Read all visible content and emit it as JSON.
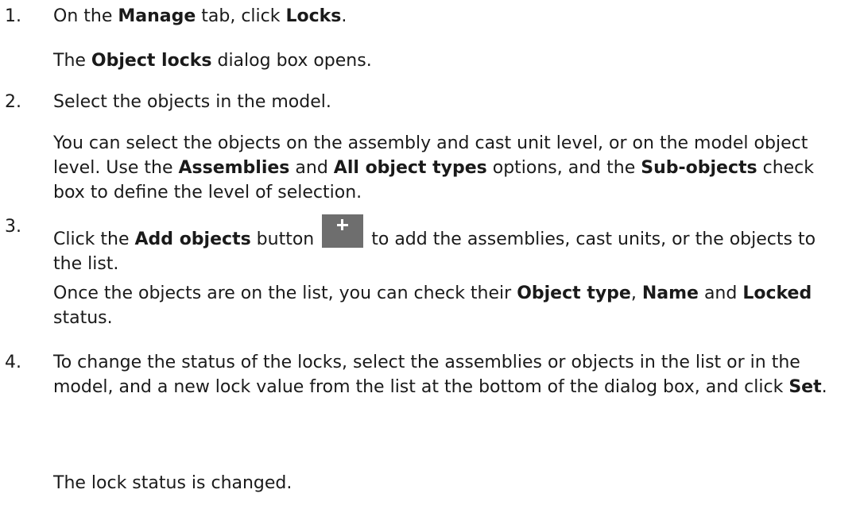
{
  "steps": [
    {
      "number": "1.",
      "line_pre": "On the ",
      "tab_name": "Manage",
      "line_mid": " tab, click ",
      "command": "Locks",
      "line_post": ".",
      "result_pre": "The ",
      "result_dialog": "Object locks",
      "result_post": " dialog box opens."
    },
    {
      "number": "2.",
      "text": "Select the objects in the model.",
      "detail_pre": "You can select the objects on the assembly and cast unit level, or on the model object level. Use the ",
      "opt1": "Assemblies",
      "and": " and ",
      "opt2": "All object types",
      "detail_mid": " options, and the ",
      "opt3": "Sub-objects",
      "detail_post": " check box to define the level of selection."
    },
    {
      "number": "3.",
      "pre": "Click the ",
      "button_name": "Add objects",
      "mid": " button ",
      "post": " to add the assemblies, cast units, or the objects to the list.",
      "detail_pre": "Once the objects are on the list, you can check their ",
      "col1": "Object type",
      "sep": ", ",
      "col2": "Name",
      "and": " and ",
      "col3": "Locked",
      "detail_post": " status."
    },
    {
      "number": "4.",
      "pre": "To change the status of the locks, select the assemblies or objects in the list or in the model, and a new lock value from the list at the bottom of the dialog box, and click ",
      "button": "Set",
      "post": ".",
      "result": "The lock status is changed."
    }
  ],
  "add_button_icon": "plus-icon"
}
